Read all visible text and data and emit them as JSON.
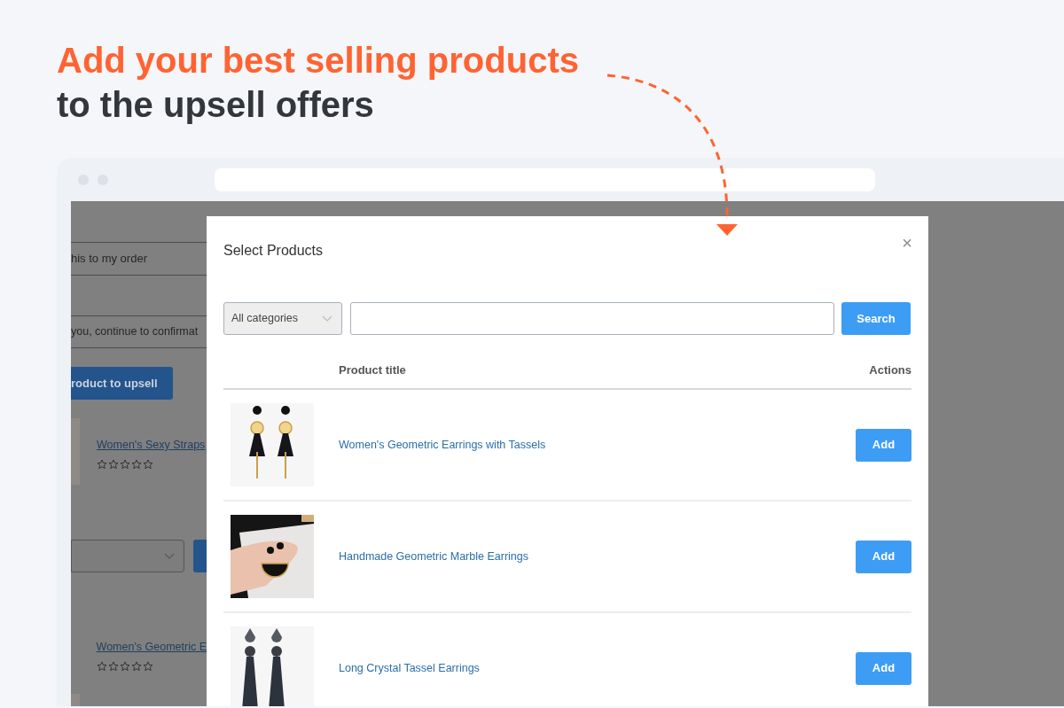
{
  "headline": {
    "highlight": "Add your best selling products",
    "rest": "to the upsell offers"
  },
  "background_page": {
    "fields": [
      "his to my order",
      "you, continue to confirmat"
    ],
    "button": "roduct to upsell",
    "products": [
      {
        "title": "Women's Sexy Straps",
        "stars": 0
      },
      {
        "title": "Women's Geometric E",
        "stars": 0
      }
    ]
  },
  "modal": {
    "title": "Select Products",
    "close": "×",
    "category": "All categories",
    "search_button": "Search",
    "columns": [
      "Product title",
      "Actions"
    ],
    "products": [
      {
        "title": "Women's Geometric Earrings with Tassels",
        "action": "Add"
      },
      {
        "title": "Handmade Geometric Marble Earrings",
        "action": "Add"
      },
      {
        "title": "Long Crystal Tassel Earrings",
        "action": "Add"
      }
    ]
  }
}
